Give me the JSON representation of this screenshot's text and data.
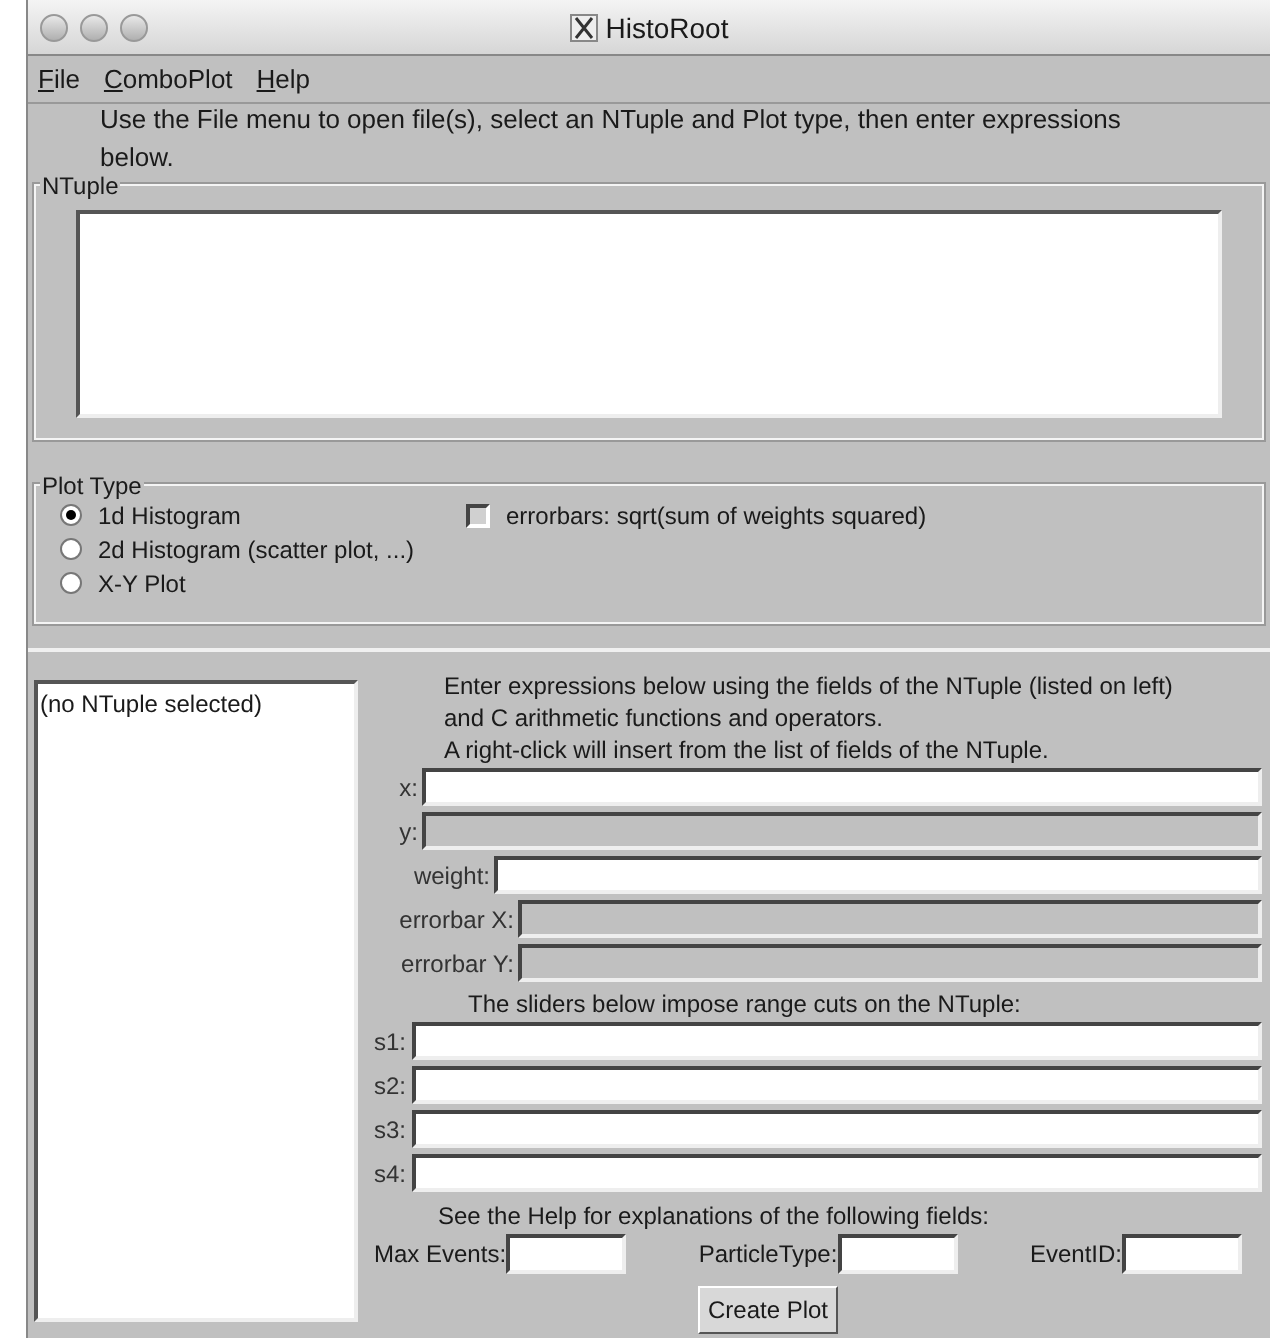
{
  "window": {
    "title": "HistoRoot"
  },
  "menu": [
    {
      "label": "File"
    },
    {
      "label": "ComboPlot"
    },
    {
      "label": "Help"
    }
  ],
  "instructions": "Use the File menu to open file(s), select an NTuple and Plot type, then enter expressions below.",
  "ntuple_group": {
    "title": "NTuple"
  },
  "plot_type": {
    "title": "Plot Type",
    "options": [
      {
        "label": "1d Histogram",
        "selected": true
      },
      {
        "label": "2d Histogram (scatter plot, ...)",
        "selected": false
      },
      {
        "label": "X-Y Plot",
        "selected": false
      }
    ],
    "errorbars": {
      "label": "errorbars: sqrt(sum of weights squared)",
      "checked": false
    }
  },
  "field_list": [
    "(no NTuple selected)"
  ],
  "help_text": [
    "Enter expressions below using the fields of the NTuple (listed on left)",
    "and C arithmetic functions and operators.",
    "A right-click will insert from the list of fields of the NTuple."
  ],
  "expressions": [
    {
      "label": "x:",
      "disabled": false
    },
    {
      "label": "y:",
      "disabled": true
    },
    {
      "label": "weight:",
      "disabled": false
    },
    {
      "label": "errorbar X:",
      "disabled": true
    },
    {
      "label": "errorbar Y:",
      "disabled": true
    }
  ],
  "sliders_text": "The sliders below impose range cuts on the NTuple:",
  "sliders": [
    {
      "label": "s1:"
    },
    {
      "label": "s2:"
    },
    {
      "label": "s3:"
    },
    {
      "label": "s4:"
    }
  ],
  "extra_text": "See the Help for explanations of the following fields:",
  "extra_fields": [
    {
      "label": "Max Events:"
    },
    {
      "label": "ParticleType:"
    },
    {
      "label": "EventID:"
    }
  ],
  "create_button": "Create Plot"
}
